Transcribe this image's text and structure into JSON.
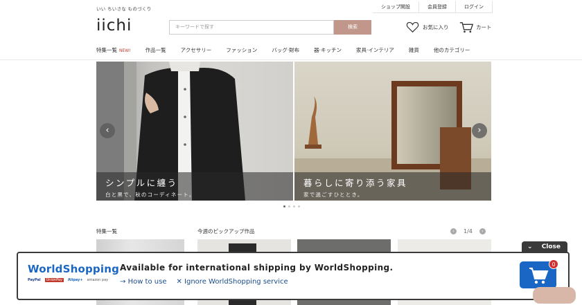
{
  "header": {
    "tagline": "いい ちいさな ものづくり",
    "top_links": [
      "ショップ開設",
      "会員登録",
      "ログイン"
    ],
    "logo": "iichi",
    "search_placeholder": "キーワードで探す",
    "search_button": "検索",
    "favorites_label": "お気に入り",
    "cart_label": "カート"
  },
  "nav": {
    "items": [
      {
        "label": "特集一覧",
        "badge": "NEW!"
      },
      {
        "label": "作品一覧"
      },
      {
        "label": "アクセサリー"
      },
      {
        "label": "ファッション"
      },
      {
        "label": "バッグ·財布"
      },
      {
        "label": "器·キッチン"
      },
      {
        "label": "家具·インテリア"
      },
      {
        "label": "雑貨"
      },
      {
        "label": "他のカテゴリー"
      }
    ]
  },
  "carousel": {
    "slides": [
      {
        "title": "シンプルに纏う",
        "subtitle": "白と黒で、秋のコーディネート。"
      },
      {
        "title": "暮らしに寄り添う家具",
        "subtitle": "家で過ごすひととき。"
      }
    ],
    "prev_icon": "‹",
    "next_icon": "›",
    "total_dots": 4,
    "active_dot": 1
  },
  "sections": {
    "features_title": "特集一覧",
    "pickup_title": "今週のピックアップ作品",
    "pager_text": "1/4"
  },
  "worldshopping": {
    "brand": "WorldShopping",
    "payments": [
      "PayPal",
      "UnionPay",
      "Alipay+",
      "amazon pay"
    ],
    "message": "Available for international shipping by WorldShopping.",
    "how_to_use": "How to use",
    "ignore": "Ignore WorldShopping service",
    "close_label": "Close",
    "cart_count": "0"
  },
  "colors": {
    "accent_search": "#c0978a",
    "ws_blue": "#1a66c4",
    "badge_red": "#d32f2f"
  }
}
